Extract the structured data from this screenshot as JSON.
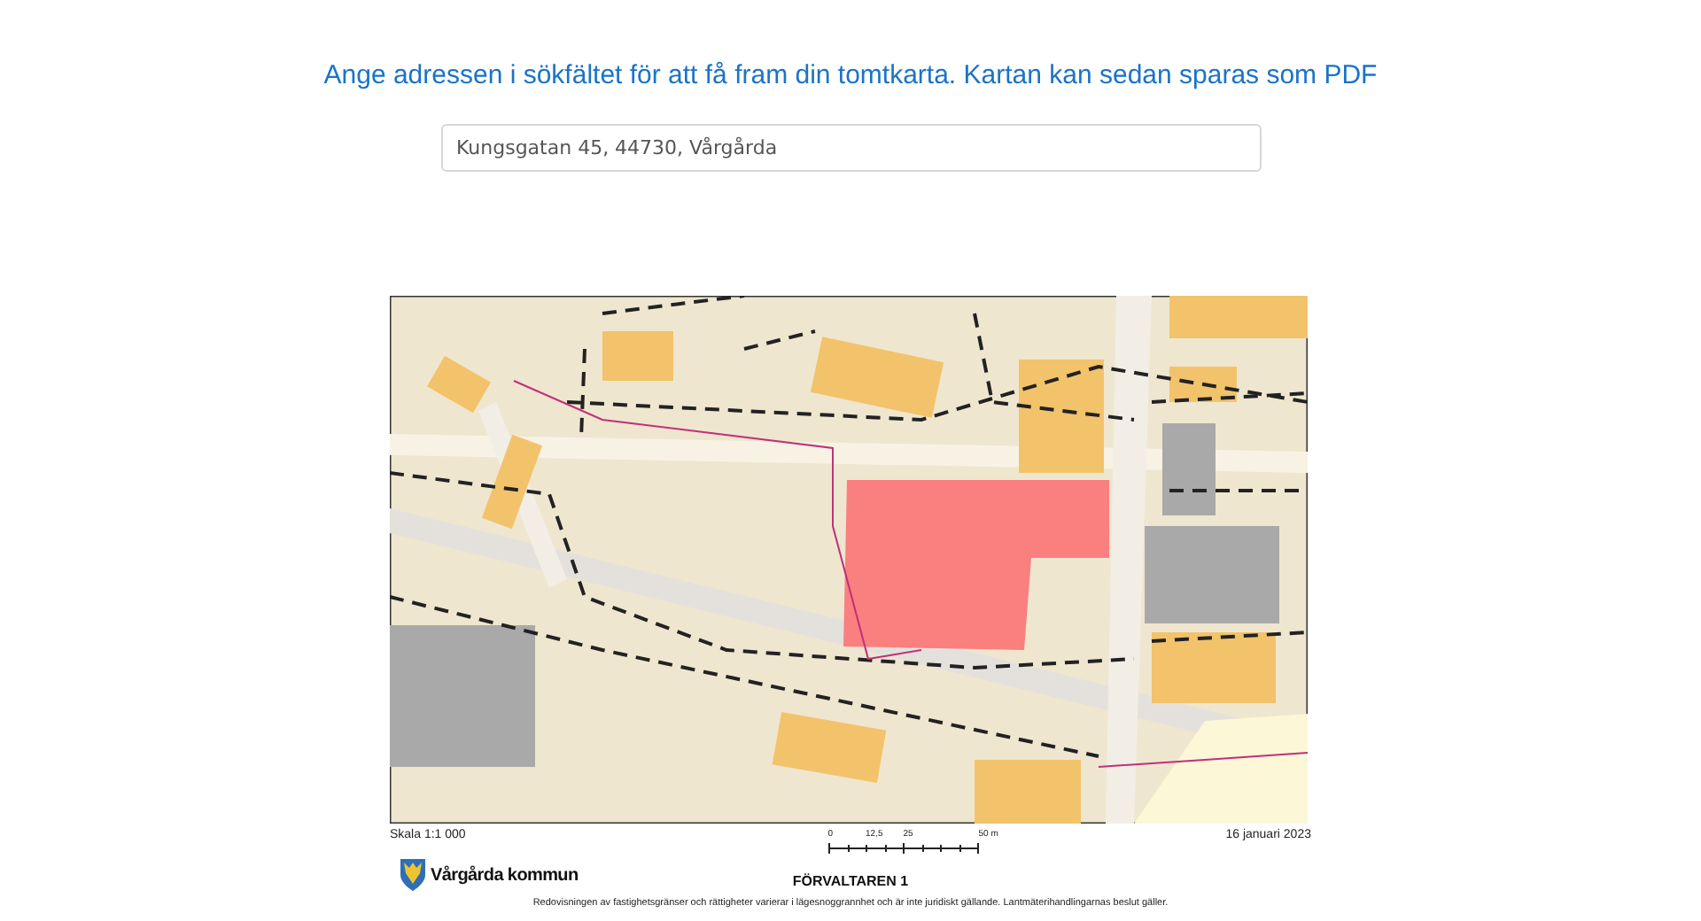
{
  "heading": "Ange adressen i sökfältet för att få fram din tomtkarta. Kartan kan sedan sparas som PDF",
  "search": {
    "value": "Kungsgatan 45, 44730, Vårgårda"
  },
  "map_footer": {
    "scale": "Skala 1:1 000",
    "date": "16 januari 2023",
    "scale_bar": {
      "ticks": [
        "0",
        "12,5",
        "25",
        "50 m"
      ]
    },
    "brand": "Vårgårda kommun",
    "title": "FÖRVALTAREN 1",
    "disclaimer": "Redovisningen av fastighetsgränser och rättigheter varierar i lägesnoggrannhet och är inte juridiskt gällande. Lantmäterihandlingarnas beslut gäller."
  }
}
